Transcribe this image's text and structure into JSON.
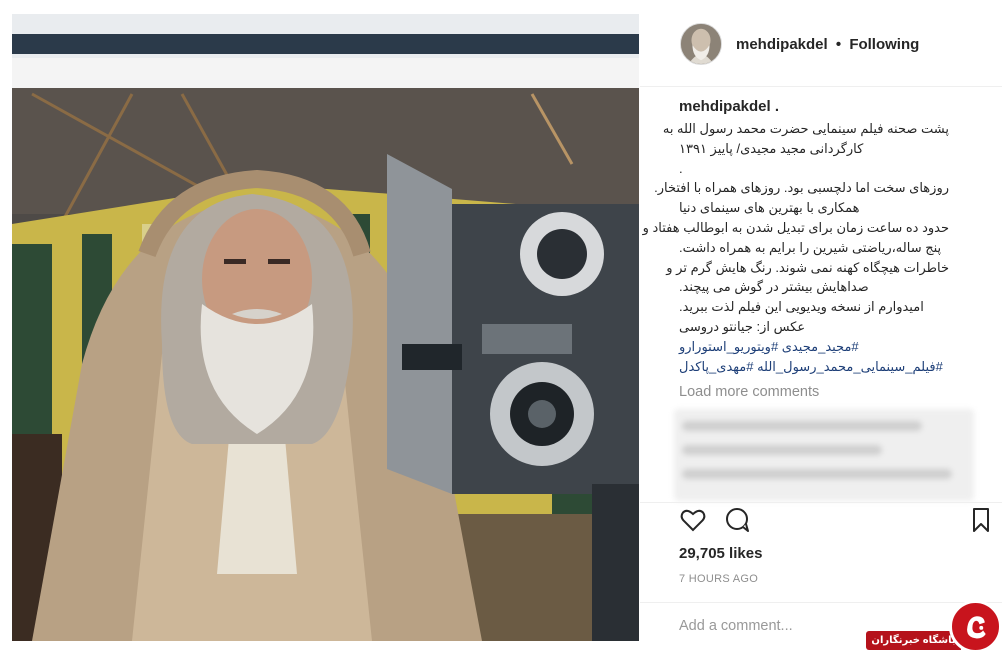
{
  "post": {
    "image_alt": "Actor in costume with long white hair and beard beside a film camera on set",
    "username": "mehdipakdel",
    "separator": "•",
    "follow_status": "Following",
    "caption": {
      "author": "mehdipakdel .",
      "lines": [
        "پشت صحنه فیلم سینمایی حضرت محمد رسول الله به",
        "کارگردانی مجید مجیدی/ پاییز ۱۳۹۱",
        ".",
        "روزهای سخت اما دلچسبی بود. روزهای همراه با افتخار.",
        "همکاری با بهترین های سینمای دنیا",
        "حدود ده ساعت زمان برای تبدیل شدن به ابوطالب هفتاد و",
        "پنج ساله،ریاضتی شیرین را برایم به همراه داشت.",
        "خاطرات هیچگاه کهنه نمی شوند. رنگ هایش گرم تر و",
        "صداهایش بیشتر در گوش می پیچند.",
        "امیدوارم از نسخه ویدیویی این فیلم لذت ببرید.",
        "عکس از: جیانتو دروسی"
      ],
      "hashtag_lines": [
        "#مجید_مجیدی #ویتوریو_استورارو",
        "#فیلم_سینمایی_محمد_رسول_الله #مهدی_پاکدل"
      ]
    },
    "load_more": "Load more comments",
    "likes": "29,705 likes",
    "timestamp": "7 HOURS AGO",
    "comment_placeholder": "Add a comment...",
    "icons": {
      "like": "heart-icon",
      "comment": "comment-icon",
      "save": "bookmark-icon"
    }
  },
  "watermark": {
    "label": "باشگاه خبرنگاران",
    "color": "#b5121b"
  },
  "colors": {
    "link": "#1e3f78",
    "muted": "#8e8e8e",
    "text": "#262626"
  }
}
